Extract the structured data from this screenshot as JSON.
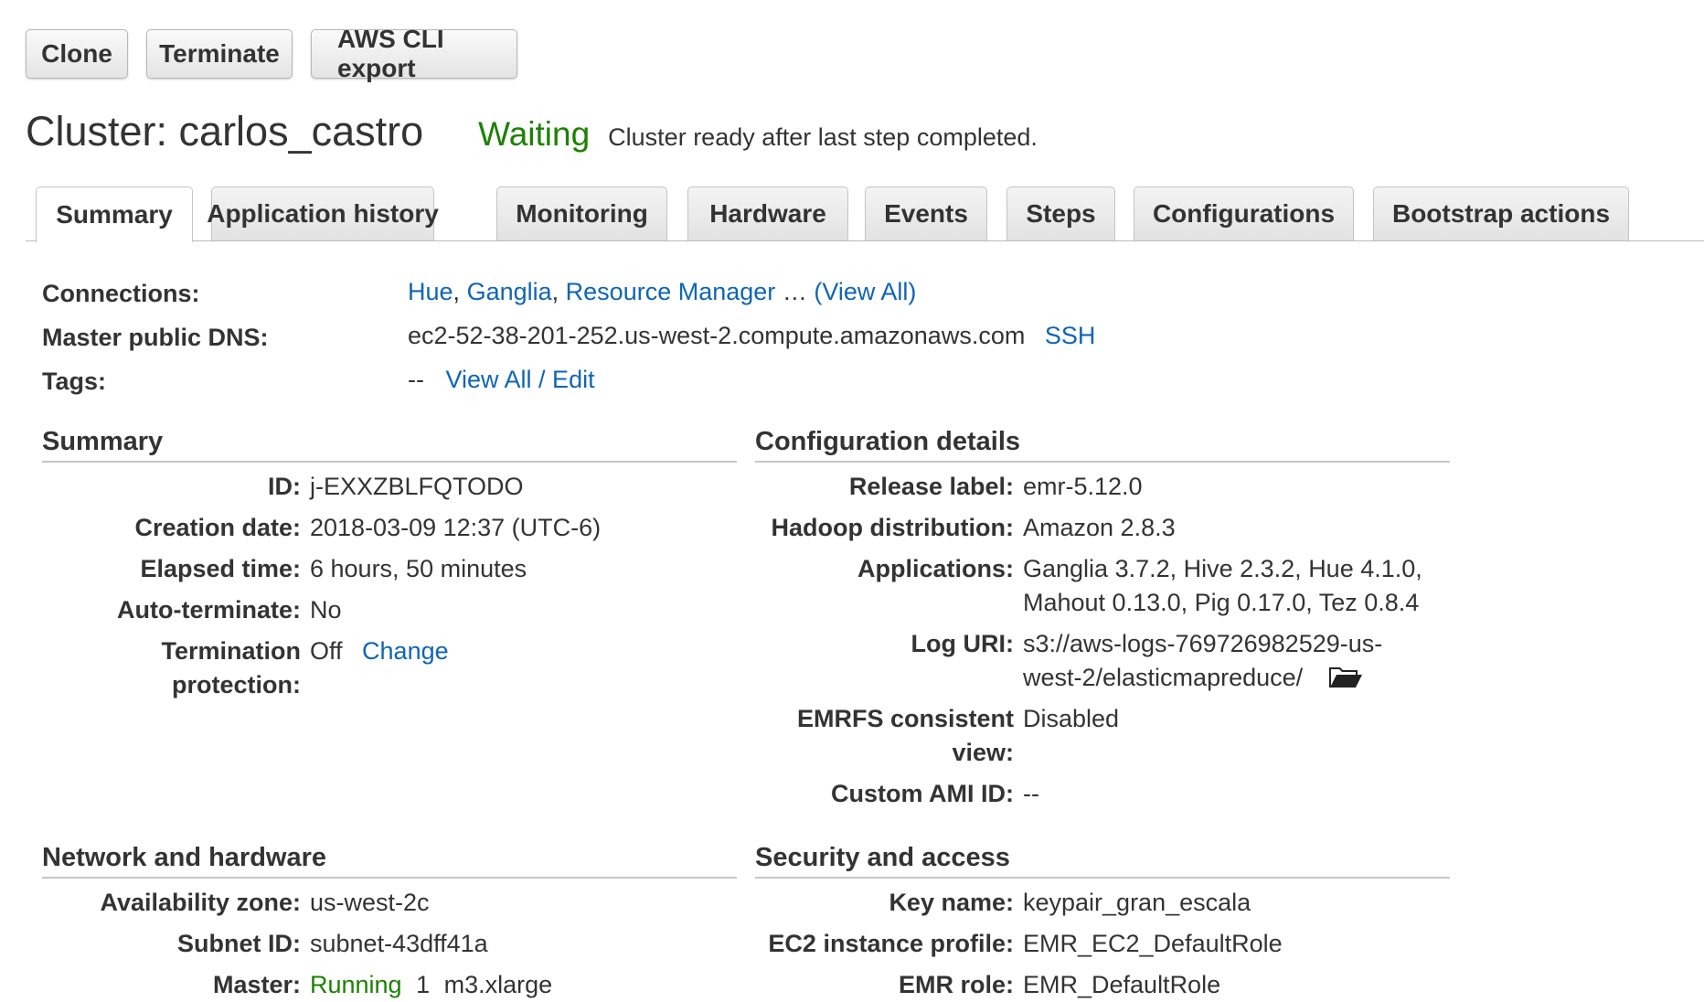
{
  "toolbar": {
    "clone": "Clone",
    "terminate": "Terminate",
    "cli_export": "AWS CLI export"
  },
  "header": {
    "title": "Cluster: carlos_castro",
    "status": "Waiting",
    "status_message": "Cluster ready after last step completed."
  },
  "tabs": [
    "Summary",
    "Application history",
    "Monitoring",
    "Hardware",
    "Events",
    "Steps",
    "Configurations",
    "Bootstrap actions"
  ],
  "connections": {
    "label": "Connections:",
    "links": [
      "Hue",
      "Ganglia",
      "Resource Manager"
    ],
    "separator": ",",
    "ellipsis": "…",
    "view_all": "(View All)"
  },
  "master_dns": {
    "label": "Master public DNS:",
    "value": "ec2-52-38-201-252.us-west-2.compute.amazonaws.com",
    "ssh": "SSH"
  },
  "tags": {
    "label": "Tags:",
    "value": "--",
    "edit": "View All / Edit"
  },
  "summary": {
    "title": "Summary",
    "id_label": "ID:",
    "id": "j-EXXZBLFQTODO",
    "creation_label": "Creation date:",
    "creation": "2018-03-09 12:37 (UTC-6)",
    "elapsed_label": "Elapsed time:",
    "elapsed": "6 hours, 50 minutes",
    "autoterm_label": "Auto-terminate:",
    "autoterm": "No",
    "termprot_label_1": "Termination",
    "termprot_label_2": "protection:",
    "termprot": "Off",
    "change": "Change"
  },
  "config": {
    "title": "Configuration details",
    "release_label": "Release label:",
    "release": "emr-5.12.0",
    "hadoop_label": "Hadoop distribution:",
    "hadoop": "Amazon 2.8.3",
    "apps_label": "Applications:",
    "apps_line1": "Ganglia 3.7.2, Hive 2.3.2, Hue 4.1.0,",
    "apps_line2": "Mahout 0.13.0, Pig 0.17.0, Tez 0.8.4",
    "log_label": "Log URI:",
    "log_line1": "s3://aws-logs-769726982529-us-",
    "log_line2": "west-2/elasticmapreduce/",
    "emrfs_label_1": "EMRFS consistent",
    "emrfs_label_2": "view:",
    "emrfs": "Disabled",
    "ami_label": "Custom AMI ID:",
    "ami": "--"
  },
  "network": {
    "title": "Network and hardware",
    "az_label": "Availability zone:",
    "az": "us-west-2c",
    "subnet_label": "Subnet ID:",
    "subnet": "subnet-43dff41a",
    "master_label": "Master:",
    "master_status": "Running",
    "master_count": "1",
    "master_type": "m3.xlarge"
  },
  "security": {
    "title": "Security and access",
    "key_label": "Key name:",
    "key": "keypair_gran_escala",
    "ec2_label": "EC2 instance profile:",
    "ec2": "EMR_EC2_DefaultRole",
    "emr_label": "EMR role:",
    "emr": "EMR_DefaultRole"
  },
  "colors": {
    "link": "#0f65b5",
    "status_green": "#1d8102"
  }
}
